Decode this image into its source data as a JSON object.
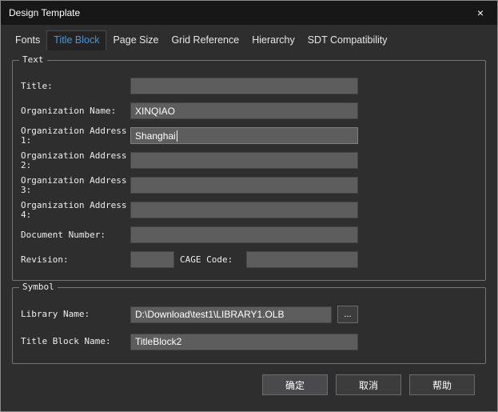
{
  "window": {
    "title": "Design Template",
    "close_label": "×"
  },
  "tabs": {
    "selected": "Title Block",
    "items": [
      {
        "label": "Fonts"
      },
      {
        "label": "Title Block"
      },
      {
        "label": "Page Size"
      },
      {
        "label": "Grid Reference"
      },
      {
        "label": "Hierarchy"
      },
      {
        "label": "SDT Compatibility"
      }
    ]
  },
  "text_group": {
    "title": "Text",
    "fields": {
      "title": {
        "label": "Title:",
        "value": ""
      },
      "org_name": {
        "label": "Organization Name:",
        "value": "XINQIAO"
      },
      "org_addr1": {
        "label": "Organization Address 1:",
        "value": "Shanghai"
      },
      "org_addr2": {
        "label": "Organization Address 2:",
        "value": ""
      },
      "org_addr3": {
        "label": "Organization Address 3:",
        "value": ""
      },
      "org_addr4": {
        "label": "Organization Address 4:",
        "value": ""
      },
      "doc_number": {
        "label": "Document Number:",
        "value": ""
      },
      "revision": {
        "label": "Revision:",
        "value": ""
      },
      "cage_code": {
        "label": "CAGE Code:",
        "value": ""
      }
    }
  },
  "symbol_group": {
    "title": "Symbol",
    "library_name": {
      "label": "Library Name:",
      "value": "D:\\Download\\test1\\LIBRARY1.OLB"
    },
    "browse_label": "...",
    "title_block_name": {
      "label": "Title Block Name:",
      "value": "TitleBlock2"
    }
  },
  "buttons": {
    "ok": "确定",
    "cancel": "取消",
    "help": "帮助"
  },
  "colors": {
    "accent": "#3d9be9",
    "focus_border": "#3393df"
  }
}
